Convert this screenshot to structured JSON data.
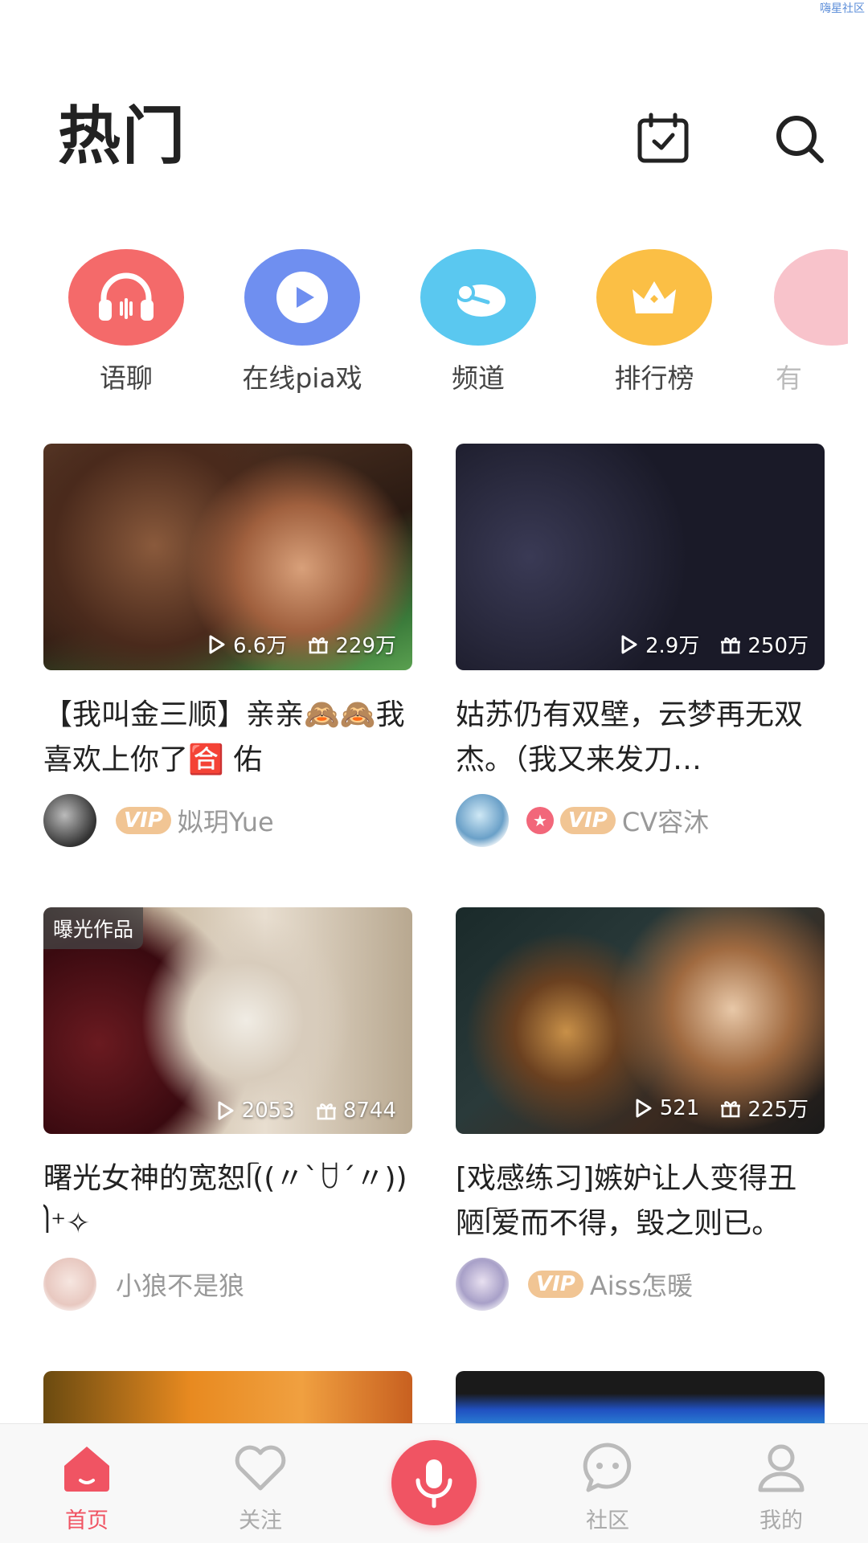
{
  "watermark": "嗨星社区",
  "header": {
    "title": "热门",
    "icons": {
      "calendar": "calendar-check-icon",
      "search": "search-icon"
    }
  },
  "categories": [
    {
      "label": "语聊",
      "icon": "headphones-icon",
      "color": "#f46a6a"
    },
    {
      "label": "在线pia戏",
      "icon": "play-icon",
      "color": "#6f8ff0"
    },
    {
      "label": "频道",
      "icon": "channel-icon",
      "color": "#5ac8f0"
    },
    {
      "label": "排行榜",
      "icon": "crown-icon",
      "color": "#fbbf45"
    },
    {
      "label": "有",
      "icon": "partial-icon",
      "color": "#f8c3cb"
    }
  ],
  "cards": [
    {
      "plays": "6.6万",
      "gifts": "229万",
      "title": "【我叫金三顺】亲亲🙈🙈我喜欢上你了🈴 佑",
      "author": "姒玥Yue",
      "vip": "VIP",
      "star": false,
      "badge": ""
    },
    {
      "plays": "2.9万",
      "gifts": "250万",
      "title": "姑苏仍有双壁，云梦再无双杰。（我又来发刀…",
      "author": "CV容沐",
      "vip": "VIP",
      "star": true,
      "badge": ""
    },
    {
      "plays": "2053",
      "gifts": "8744",
      "title": "曙光女神的宽恕ᥬ((〃`ꇴ´〃))ᩤ⁺✧",
      "author": "小狼不是狼",
      "vip": "",
      "star": false,
      "badge": "曝光作品"
    },
    {
      "plays": "521",
      "gifts": "225万",
      "title": "[戏感练习]嫉妒让人变得丑陋ᥬ爱而不得，毁之则已。",
      "author": "Aiss怎暖",
      "vip": "VIP",
      "star": false,
      "badge": ""
    }
  ],
  "bottom_nav": [
    {
      "label": "首页",
      "icon": "home-icon",
      "active": true
    },
    {
      "label": "关注",
      "icon": "heart-icon",
      "active": false
    },
    {
      "label": "",
      "icon": "microphone-icon",
      "active": false
    },
    {
      "label": "社区",
      "icon": "chat-bubble-icon",
      "active": false
    },
    {
      "label": "我的",
      "icon": "user-icon",
      "active": false
    }
  ],
  "colors": {
    "accent": "#f05463",
    "vip": "#f1c594"
  }
}
